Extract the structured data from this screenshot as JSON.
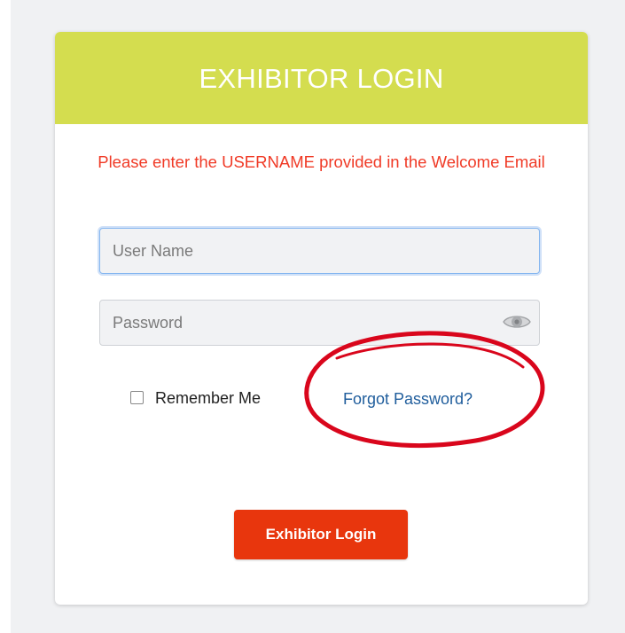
{
  "header": {
    "title": "EXHIBITOR LOGIN"
  },
  "notice": {
    "text": "Please enter the USERNAME provided in the Welcome Email"
  },
  "form": {
    "username_placeholder": "User Name",
    "username_value": "",
    "password_placeholder": "Password",
    "password_value": "",
    "remember_label": "Remember Me",
    "remember_checked": false,
    "forgot_label": "Forgot Password?",
    "submit_label": "Exhibitor Login"
  },
  "icons": {
    "password_toggle": "eye-icon"
  },
  "colors": {
    "header_bg": "#d4dd4f",
    "notice_text": "#f03a26",
    "link": "#1f5d9c",
    "button_bg": "#e8360d",
    "annotation": "#d9061c"
  }
}
